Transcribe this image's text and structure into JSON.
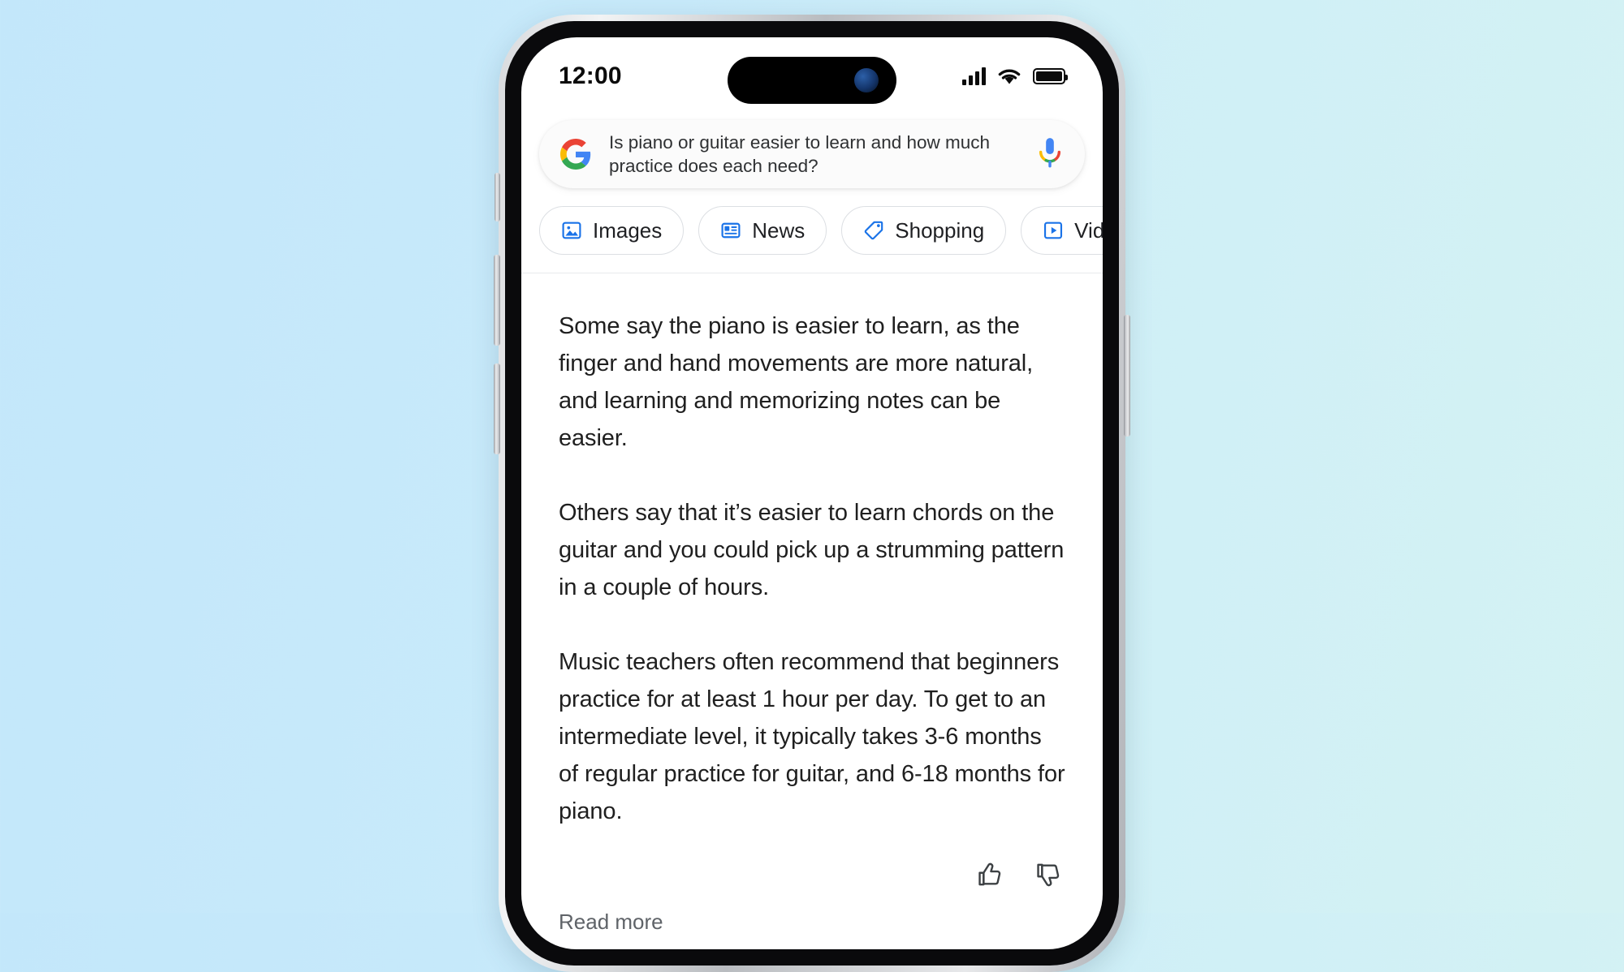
{
  "background": {
    "gradient_from": "#c3e7fa",
    "gradient_to": "#d4f2f3"
  },
  "device": {
    "frame_color": "#c9ccd0",
    "bezel_color": "#0a0a0c",
    "buttons": [
      "mute-switch",
      "volume-up",
      "volume-down",
      "power-button"
    ]
  },
  "status_bar": {
    "time": "12:00",
    "signal_icon": "cellular-signal-icon",
    "signal_bars": 4,
    "wifi_icon": "wifi-icon",
    "battery_icon": "battery-full-icon",
    "battery_level": 100,
    "dynamic_island": "dynamic-island",
    "camera": "front-camera"
  },
  "search": {
    "logo": "google-g-logo",
    "query": "Is piano or guitar easier to learn and how much practice does each need?",
    "placeholder": "Search",
    "mic_icon": "google-mic-icon"
  },
  "chips": [
    {
      "label": "Images",
      "icon": "images-icon"
    },
    {
      "label": "News",
      "icon": "news-icon"
    },
    {
      "label": "Shopping",
      "icon": "shopping-tag-icon"
    },
    {
      "label": "Videos",
      "icon": "videos-play-icon"
    }
  ],
  "answer": {
    "paragraphs": [
      "Some say the piano is easier to learn, as the finger and hand movements are more natural, and learning and memorizing notes can be easier.",
      "Others say that it’s easier to learn chords on the guitar and you could pick up a strumming pattern in a couple of hours.",
      "Music teachers often recommend that beginners practice for at least 1 hour per day. To get to an intermediate level, it typically takes 3-6 months of regular practice for guitar, and 6-18 months for piano."
    ],
    "read_more_label": "Read more"
  },
  "feedback": {
    "thumbs_up_icon": "thumbs-up-icon",
    "thumbs_down_icon": "thumbs-down-icon"
  },
  "colors": {
    "accent_blue": "#1a73e8",
    "google_red": "#ea4335",
    "google_yellow": "#fbbc05",
    "google_green": "#34a853",
    "text_primary": "#1f1f1f",
    "text_secondary": "#5f6368"
  }
}
